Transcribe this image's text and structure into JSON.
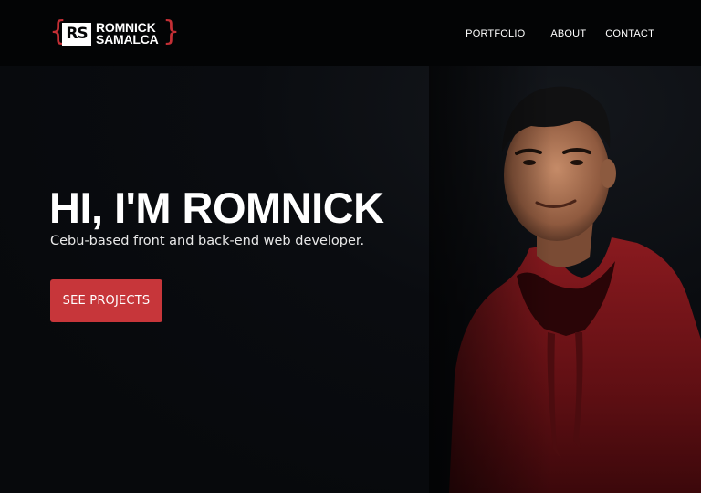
{
  "brand": {
    "monogram": "RS",
    "first_name": "ROMNICK",
    "last_name": "SAMALCA",
    "accent_color": "#c7363a"
  },
  "nav": {
    "items": [
      {
        "label": "PORTFOLIO"
      },
      {
        "label": "ABOUT"
      },
      {
        "label": "CONTACT"
      }
    ]
  },
  "hero": {
    "title": "HI, I'M ROMNICK",
    "subtitle": "Cebu-based front and back-end web developer.",
    "cta_label": "SEE PROJECTS",
    "portrait": "portrait photo of man in red hoodie"
  }
}
